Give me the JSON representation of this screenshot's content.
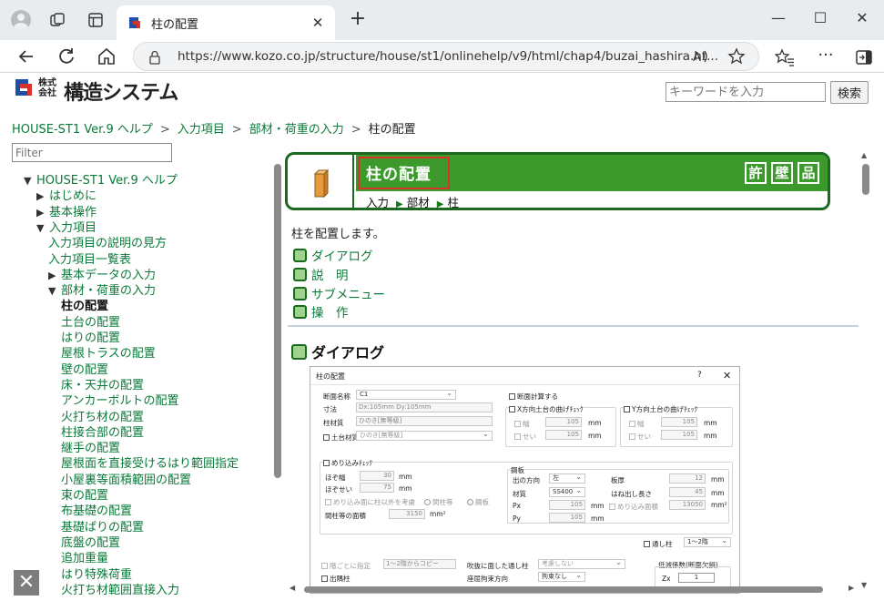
{
  "browser": {
    "tab_title": "柱の配置",
    "url": "https://www.kozo.co.jp/structure/house/st1/onlinehelp/v9/html/chap4/buzai_hashira.ht..."
  },
  "site": {
    "logo_small": "株式\n会社",
    "logo_big": "構造システム",
    "search_placeholder": "キーワードを入力",
    "search_button": "検索",
    "brand_colors": {
      "green": "#3c9a2c",
      "dark_green": "#1a6b1f",
      "link": "#0a7a3a",
      "highlight_red": "#d9322a"
    }
  },
  "breadcrumb": [
    "HOUSE-ST1 Ver.9 ヘルプ",
    "入力項目",
    "部材・荷重の入力",
    "柱の配置"
  ],
  "sidebar": {
    "filter_placeholder": "Filter",
    "items": [
      {
        "label": "HOUSE-ST1 Ver.9 ヘルプ",
        "arrow": "▼"
      },
      {
        "label": "はじめに",
        "arrow": "▶"
      },
      {
        "label": "基本操作",
        "arrow": "▶"
      },
      {
        "label": "入力項目",
        "arrow": "▼"
      },
      {
        "label": "入力項目の説明の見方",
        "arrow": ""
      },
      {
        "label": "入力項目一覧表",
        "arrow": ""
      },
      {
        "label": "基本データの入力",
        "arrow": "▶"
      },
      {
        "label": "部材・荷重の入力",
        "arrow": "▼"
      },
      {
        "label": "柱の配置",
        "arrow": ""
      },
      {
        "label": "土台の配置",
        "arrow": ""
      },
      {
        "label": "はりの配置",
        "arrow": ""
      },
      {
        "label": "屋根トラスの配置",
        "arrow": ""
      },
      {
        "label": "壁の配置",
        "arrow": ""
      },
      {
        "label": "床・天井の配置",
        "arrow": ""
      },
      {
        "label": "アンカーボルトの配置",
        "arrow": ""
      },
      {
        "label": "火打ち材の配置",
        "arrow": ""
      },
      {
        "label": "柱接合部の配置",
        "arrow": ""
      },
      {
        "label": "継手の配置",
        "arrow": ""
      },
      {
        "label": "屋根面を直接受けるはり範囲指定",
        "arrow": ""
      },
      {
        "label": "小屋裏等面積範囲の配置",
        "arrow": ""
      },
      {
        "label": "束の配置",
        "arrow": ""
      },
      {
        "label": "布基礎の配置",
        "arrow": ""
      },
      {
        "label": "基礎ばりの配置",
        "arrow": ""
      },
      {
        "label": "底盤の配置",
        "arrow": ""
      },
      {
        "label": "追加重量",
        "arrow": ""
      },
      {
        "label": "はり特殊荷重",
        "arrow": ""
      },
      {
        "label": "火打ち材範囲直接入力",
        "arrow": ""
      }
    ],
    "close_label": "✕"
  },
  "banner": {
    "title": "柱の配置",
    "badges": [
      "許",
      "壁",
      "品"
    ],
    "path": [
      "入力",
      "部材",
      "柱"
    ]
  },
  "main": {
    "intro": "柱を配置します。",
    "toc": [
      "ダイアログ",
      "説　明",
      "サブメニュー",
      "操　作"
    ],
    "section_title": "ダイアログ"
  },
  "dialog": {
    "title": "柱の配置",
    "help": "?",
    "close": "✕",
    "section_name_label": "断面名称",
    "section_name_value": "C1",
    "size_label": "寸法",
    "size_value": "Dx:105mm  Dy:105mm",
    "material_label": "柱材質",
    "material_value": "ひのき[無等級]",
    "sill_material_label": "土台材質",
    "sill_material_value": "ひのき[無等級]",
    "section_calc_label": "断面計算する",
    "x_check_label": "X方向土台の曲げﾁｪｯｸ",
    "y_check_label": "Y方向土台の曲げﾁｪｯｸ",
    "width_label": "幅",
    "depth_label": "せい",
    "x_width": "105",
    "x_depth": "105",
    "y_width": "105",
    "y_depth": "105",
    "unit_mm": "mm",
    "embed_check_label": "めり込みﾁｪｯｸ",
    "tenon_width_label": "ほぞ幅",
    "tenon_width": "30",
    "tenon_depth_label": "ほぞせい",
    "tenon_depth": "75",
    "embed_other_label": "めり込み面に柱以外を考慮",
    "radio_column": "間柱等",
    "radio_steel": "鋼板",
    "stud_area_label": "間柱等の面積",
    "stud_area": "3150",
    "unit_mm2": "mm²",
    "steel_group_label": "鋼板",
    "direction_label": "出の方向",
    "direction_value": "左",
    "plate_thickness_label": "板厚",
    "plate_thickness": "12",
    "steel_material_label": "材質",
    "steel_material_value": "SS400",
    "overhang_label": "はね出し長さ",
    "overhang": "45",
    "px_label": "Px",
    "px": "105",
    "embed_area_label": "めり込み面積",
    "embed_area": "13050",
    "py_label": "Py",
    "py": "105",
    "through_column_label": "通し柱",
    "through_column_value": "1〜2階",
    "per_floor_label": "階ごとに指定",
    "per_floor_value": "1〜2階からコピー",
    "atrium_label": "吹抜に面した通し柱",
    "atrium_value": "考慮しない",
    "reduction_label": "低減係数(断面欠損)",
    "overhang_col_label": "出隅柱",
    "seat_label": "座屈拘束方向",
    "seat_value": "拘束なし",
    "zx_label": "Zx",
    "zx": "1"
  }
}
